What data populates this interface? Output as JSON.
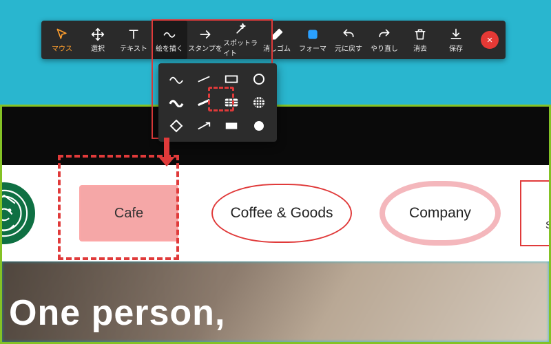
{
  "colors": {
    "accent": "#e03a3a",
    "toolbar_bg": "#2a2a2a",
    "page_bg": "#29b6cf",
    "logo_green": "#0f7043",
    "green_border": "#84c225"
  },
  "toolbar": {
    "items": [
      {
        "key": "mouse",
        "label": "マウス",
        "icon": "cursor",
        "color": "orange"
      },
      {
        "key": "select",
        "label": "選択",
        "icon": "move"
      },
      {
        "key": "text",
        "label": "テキスト",
        "icon": "text"
      },
      {
        "key": "draw",
        "label": "絵を描く",
        "icon": "tilde",
        "active": true
      },
      {
        "key": "stamp",
        "label": "スタンプを",
        "icon": "arrow-right"
      },
      {
        "key": "spot",
        "label": "スポットライト",
        "icon": "wand"
      },
      {
        "key": "eraser",
        "label": "消しゴム",
        "icon": "eraser"
      },
      {
        "key": "format",
        "label": "フォーマ",
        "icon": "format",
        "color": "blue"
      },
      {
        "key": "undo",
        "label": "元に戻す",
        "icon": "undo"
      },
      {
        "key": "redo",
        "label": "やり直し",
        "icon": "redo"
      },
      {
        "key": "clear",
        "label": "消去",
        "icon": "trash"
      },
      {
        "key": "save",
        "label": "保存",
        "icon": "download"
      }
    ],
    "close": "×"
  },
  "draw_popup": {
    "cells": [
      "wave",
      "line",
      "rect-outline",
      "circle-outline",
      "wave-thick",
      "line-thick",
      "rect-grid",
      "circle-grid",
      "diamond-outline",
      "arrow-line",
      "rect-solid",
      "circle-solid"
    ],
    "focused_index": 6
  },
  "page_nav": {
    "items": [
      {
        "key": "cafe",
        "label": "Cafe"
      },
      {
        "key": "coffee",
        "label": "Coffee & Goods"
      },
      {
        "key": "company",
        "label": "Company"
      },
      {
        "key": "service",
        "label": "Service",
        "icon": "user"
      }
    ]
  },
  "hero": {
    "title": "One person,"
  }
}
